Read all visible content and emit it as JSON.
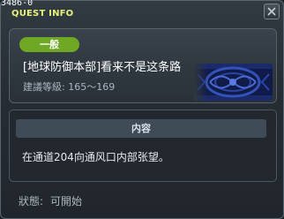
{
  "window": {
    "id_label": "3486-0",
    "title": "QUEST INFO",
    "close_icon": "close-icon"
  },
  "quest": {
    "category": "一般",
    "name": "[地球防御本部]看来不是这条路",
    "level_label": "建議等級:",
    "level_range": "165～169",
    "image_icon": "quest-emblem-image"
  },
  "content": {
    "header": "内容",
    "text": "在通道204向通风口内部张望。"
  },
  "status": {
    "label": "狀態:",
    "value": "可開始"
  },
  "colors": {
    "title_accent": "#e6f27a",
    "category_badge": "#6fa825",
    "level_text": "#a9b6c2"
  }
}
